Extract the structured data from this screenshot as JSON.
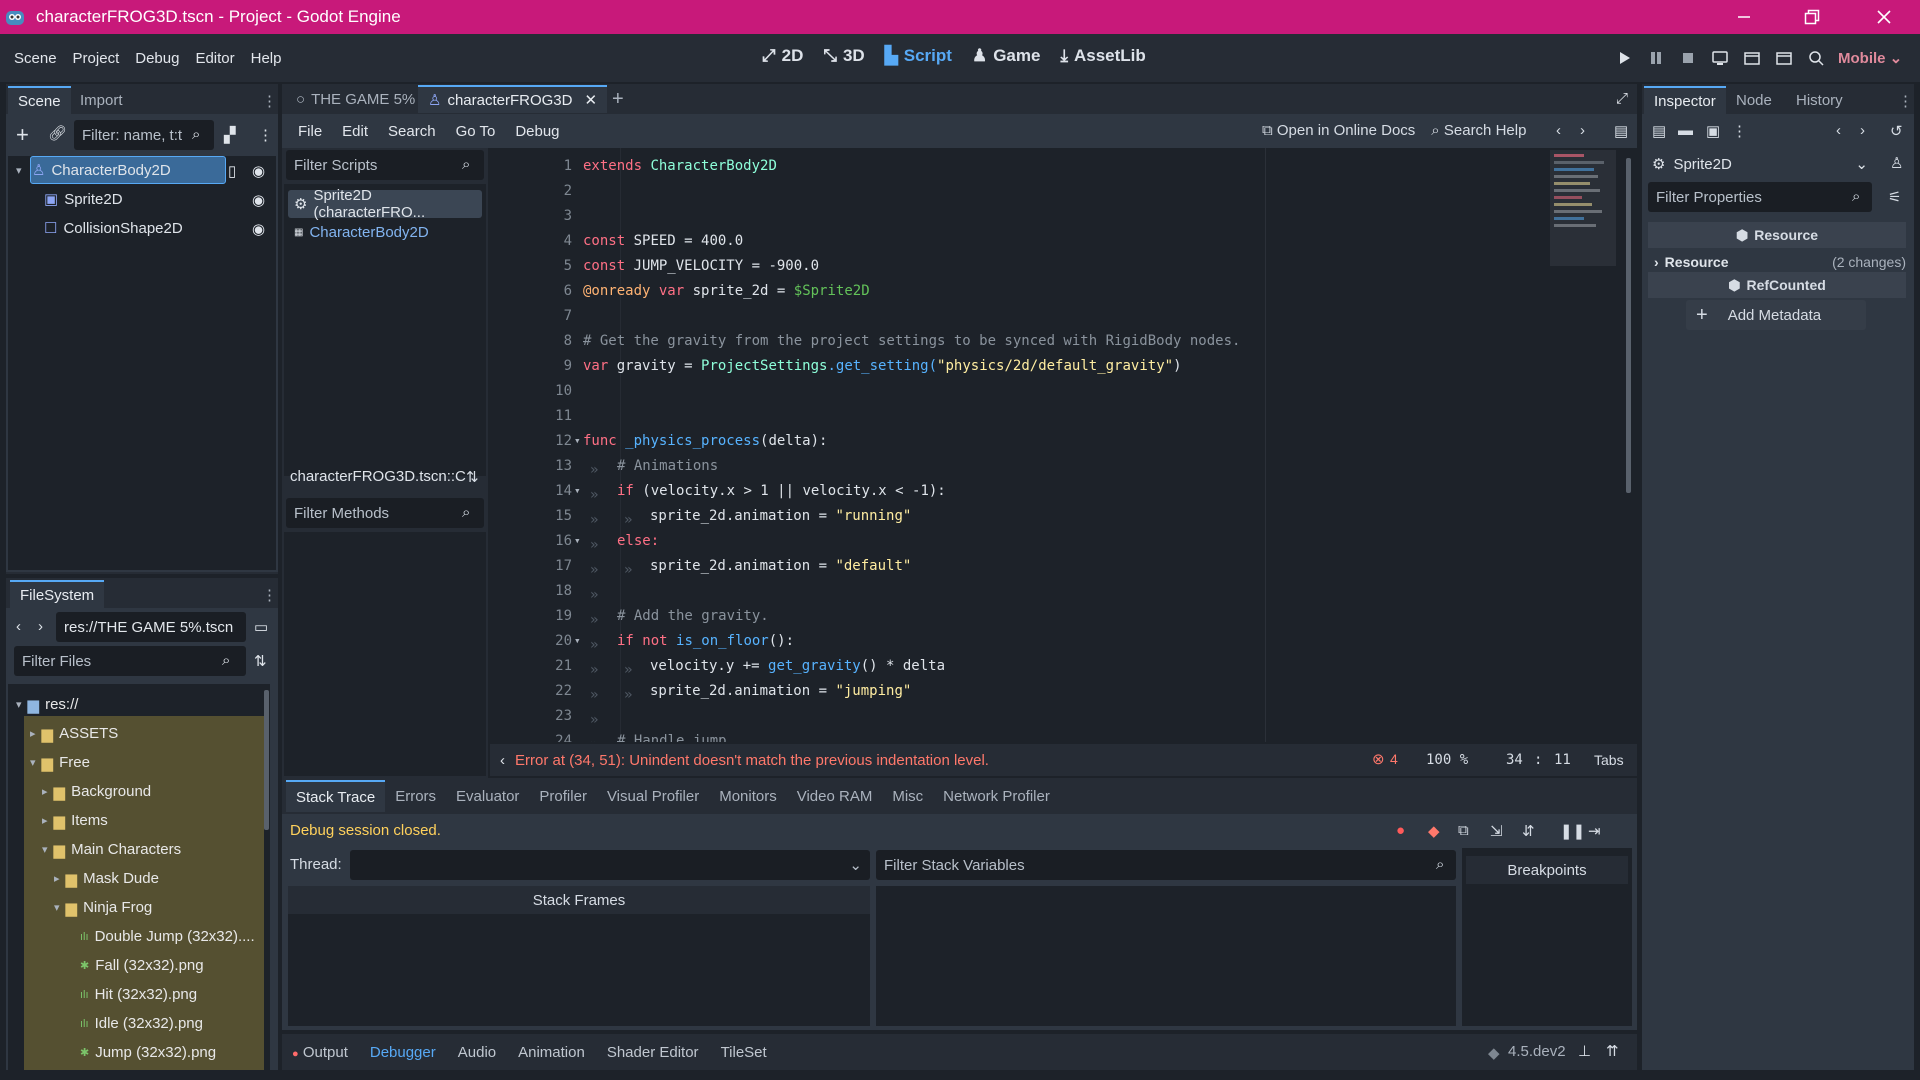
{
  "window": {
    "title": "characterFROG3D.tscn - Project - Godot Engine"
  },
  "menubar": {
    "menus": [
      "Scene",
      "Project",
      "Debug",
      "Editor",
      "Help"
    ],
    "workspaces": [
      "2D",
      "3D",
      "Script",
      "Game",
      "AssetLib"
    ],
    "renderer": "Mobile"
  },
  "scene_dock": {
    "tabs": [
      "Scene",
      "Import"
    ],
    "filter_placeholder": "Filter: name, t:t",
    "nodes": [
      "CharacterBody2D",
      "Sprite2D",
      "CollisionShape2D"
    ]
  },
  "filesystem": {
    "tab": "FileSystem",
    "path": "res://THE GAME 5%.tscn",
    "filter_placeholder": "Filter Files",
    "items": [
      "res://",
      "ASSETS",
      "Free",
      "Background",
      "Items",
      "Main Characters",
      "Mask Dude",
      "Ninja Frog",
      "Double Jump (32x32)....",
      "Fall (32x32).png",
      "Hit (32x32).png",
      "Idle (32x32).png",
      "Jump (32x32).png"
    ]
  },
  "editor_tabs": {
    "tabs": [
      "THE GAME 5%",
      "characterFROG3D"
    ]
  },
  "script_editor": {
    "menus": [
      "File",
      "Edit",
      "Search",
      "Go To",
      "Debug"
    ],
    "online_docs": "Open in Online Docs",
    "search_help": "Search Help",
    "filter_scripts": "Filter Scripts",
    "scripts": [
      "Sprite2D (characterFRO...",
      "CharacterBody2D"
    ],
    "current_file": "characterFROG3D.tscn::C",
    "filter_methods": "Filter Methods",
    "error": "Error at (34, 51): Unindent doesn't match the previous indentation level.",
    "error_count": "4",
    "zoom": "100 %",
    "line": "34",
    "col": "11",
    "indent": "Tabs"
  },
  "code": {
    "l1a": "extends",
    "l1b": "CharacterBody2D",
    "l4a": "const",
    "l4b": "SPEED = 400.0",
    "l5a": "const",
    "l5b": "JUMP_VELOCITY = -900.0",
    "l6a": "@onready",
    "l6b": "var",
    "l6c": "sprite_2d =",
    "l6d": "$Sprite2D",
    "l8": "# Get the gravity from the project settings to be synced with RigidBody nodes.",
    "l9a": "var",
    "l9b": "gravity =",
    "l9c": "ProjectSettings",
    "l9d": ".get_setting(",
    "l9e": "\"physics/2d/default_gravity\"",
    "l9f": ")",
    "l12a": "func",
    "l12b": "_physics_process",
    "l12c": "(delta):",
    "l13": "# Animations",
    "l14a": "if",
    "l14b": "(velocity.x > 1 || velocity.x < -1):",
    "l15a": "sprite_2d.animation =",
    "l15b": "\"running\"",
    "l16": "else:",
    "l17a": "sprite_2d.animation =",
    "l17b": "\"default\"",
    "l19": "# Add the gravity.",
    "l20a": "if not",
    "l20b": "is_on_floor",
    "l20c": "():",
    "l21a": "velocity.y +=",
    "l21b": "get_gravity",
    "l21c": "() * delta",
    "l22a": "sprite_2d.animation =",
    "l22b": "\"jumping\"",
    "l24": "# Handle jump."
  },
  "inspector": {
    "tabs": [
      "Inspector",
      "Node",
      "History"
    ],
    "object": "Sprite2D",
    "filter_placeholder": "Filter Properties",
    "section_resource": "Resource",
    "resource_label": "Resource",
    "resource_changes": "(2 changes)",
    "section_refcounted": "RefCounted",
    "add_metadata": "Add Metadata"
  },
  "debugger": {
    "tabs": [
      "Stack Trace",
      "Errors",
      "Evaluator",
      "Profiler",
      "Visual Profiler",
      "Monitors",
      "Video RAM",
      "Misc",
      "Network Profiler"
    ],
    "status": "Debug session closed.",
    "thread_label": "Thread:",
    "filter_vars": "Filter Stack Variables",
    "stack_frames": "Stack Frames",
    "breakpoints": "Breakpoints"
  },
  "bottom_bar": {
    "tabs": [
      "Output",
      "Debugger",
      "Audio",
      "Animation",
      "Shader Editor",
      "TileSet"
    ],
    "version": "4.5.dev2"
  },
  "colors": {
    "accent": "#57a9f5",
    "titlebar": "#c8197a",
    "error": "#ff786b",
    "warning": "#ffd15c",
    "folder_highlight": "#555031"
  }
}
